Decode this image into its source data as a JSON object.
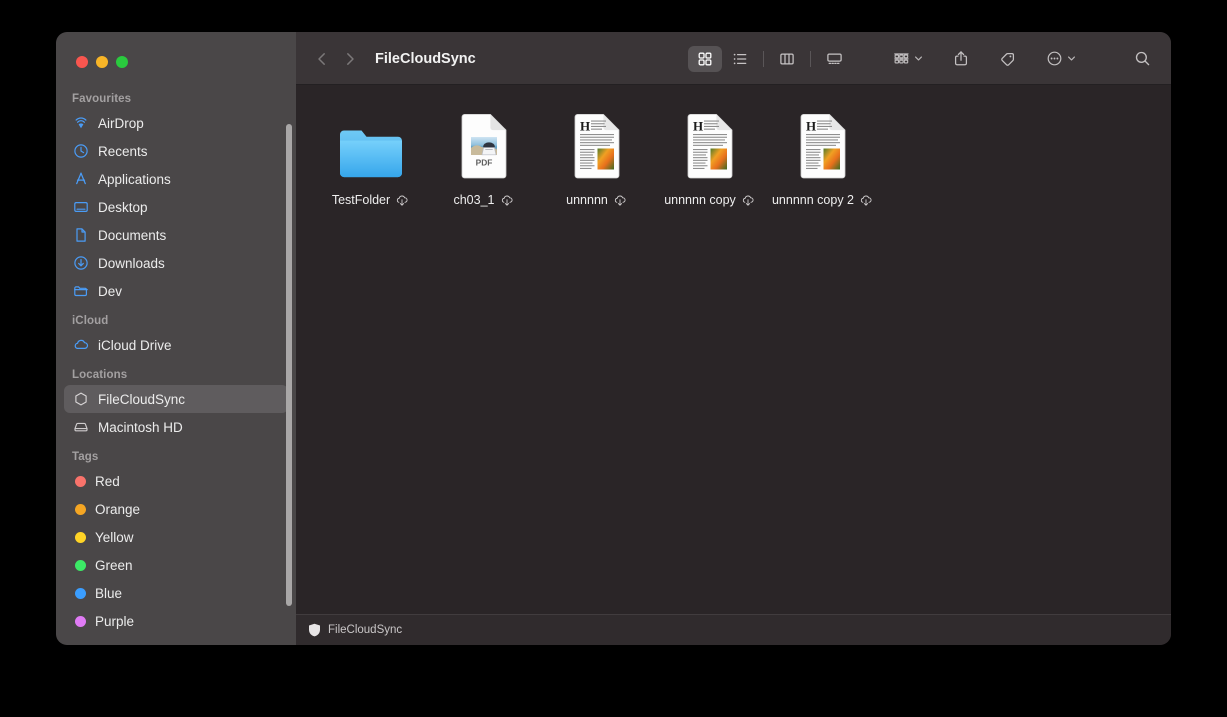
{
  "window": {
    "traffic_lights": [
      {
        "name": "close",
        "color": "#F9564F"
      },
      {
        "name": "minimize",
        "color": "#F8B527"
      },
      {
        "name": "zoom",
        "color": "#2ACA3E"
      }
    ]
  },
  "sidebar": {
    "groups": [
      {
        "title": "Favourites",
        "items": [
          {
            "label": "AirDrop",
            "icon": "airdrop-icon",
            "selected": false
          },
          {
            "label": "Recents",
            "icon": "clock-icon",
            "selected": false
          },
          {
            "label": "Applications",
            "icon": "applications-icon",
            "selected": false
          },
          {
            "label": "Desktop",
            "icon": "desktop-icon",
            "selected": false
          },
          {
            "label": "Documents",
            "icon": "document-icon",
            "selected": false
          },
          {
            "label": "Downloads",
            "icon": "download-icon",
            "selected": false
          },
          {
            "label": "Dev",
            "icon": "folder-icon",
            "selected": false
          }
        ]
      },
      {
        "title": "iCloud",
        "items": [
          {
            "label": "iCloud Drive",
            "icon": "cloud-icon",
            "selected": false
          }
        ]
      },
      {
        "title": "Locations",
        "items": [
          {
            "label": "FileCloudSync",
            "icon": "hexagon-icon",
            "selected": true
          },
          {
            "label": "Macintosh HD",
            "icon": "harddrive-icon",
            "selected": false
          }
        ]
      },
      {
        "title": "Tags",
        "items": [
          {
            "label": "Red",
            "icon": "tag-dot",
            "color": "#F9736B",
            "selected": false
          },
          {
            "label": "Orange",
            "icon": "tag-dot",
            "color": "#F5A623",
            "selected": false
          },
          {
            "label": "Yellow",
            "icon": "tag-dot",
            "color": "#FFD426",
            "selected": false
          },
          {
            "label": "Green",
            "icon": "tag-dot",
            "color": "#3CE966",
            "selected": false
          },
          {
            "label": "Blue",
            "icon": "tag-dot",
            "color": "#3B9EFF",
            "selected": false
          },
          {
            "label": "Purple",
            "icon": "tag-dot",
            "color": "#E07BF5",
            "selected": false
          }
        ]
      }
    ]
  },
  "toolbar": {
    "back_icon": "chevron-left-icon",
    "forward_icon": "chevron-right-icon",
    "title": "FileCloudSync",
    "view_modes": [
      {
        "name": "icon-view",
        "icon": "grid-icon",
        "active": true
      },
      {
        "name": "list-view",
        "icon": "list-icon",
        "active": false
      },
      {
        "name": "column-view",
        "icon": "columns-icon",
        "active": false
      },
      {
        "name": "gallery-view",
        "icon": "gallery-icon",
        "active": false
      }
    ],
    "actions": [
      {
        "name": "group-by",
        "icon": "group-icon",
        "has_chevron": true
      },
      {
        "name": "share",
        "icon": "share-icon",
        "has_chevron": false
      },
      {
        "name": "tags",
        "icon": "tag-icon",
        "has_chevron": false
      },
      {
        "name": "more",
        "icon": "ellipsis-circle-icon",
        "has_chevron": true
      }
    ],
    "search_icon": "search-icon"
  },
  "content": {
    "files": [
      {
        "name": "TestFolder",
        "kind": "folder",
        "badge": "cloud-download-icon"
      },
      {
        "name": "ch03_1",
        "kind": "pdf",
        "badge": "cloud-download-icon"
      },
      {
        "name": "unnnnn",
        "kind": "document",
        "badge": "cloud-download-icon"
      },
      {
        "name": "unnnnn copy",
        "kind": "document",
        "badge": "cloud-download-icon"
      },
      {
        "name": "unnnnn copy 2",
        "kind": "document",
        "badge": "cloud-download-icon"
      }
    ],
    "pdf_badge_text": "PDF"
  },
  "statusbar": {
    "icon": "shield-icon",
    "label": "FileCloudSync"
  },
  "colors": {
    "sidebar_bg": "#4a4748",
    "content_bg": "#2a2527",
    "toolbar_bg": "#3a3537",
    "statusbar_bg": "#302b2d",
    "selection": "#5f5c5e",
    "accent_blue": "#4a9cf6",
    "folder_blue": "#4fb5f0"
  }
}
